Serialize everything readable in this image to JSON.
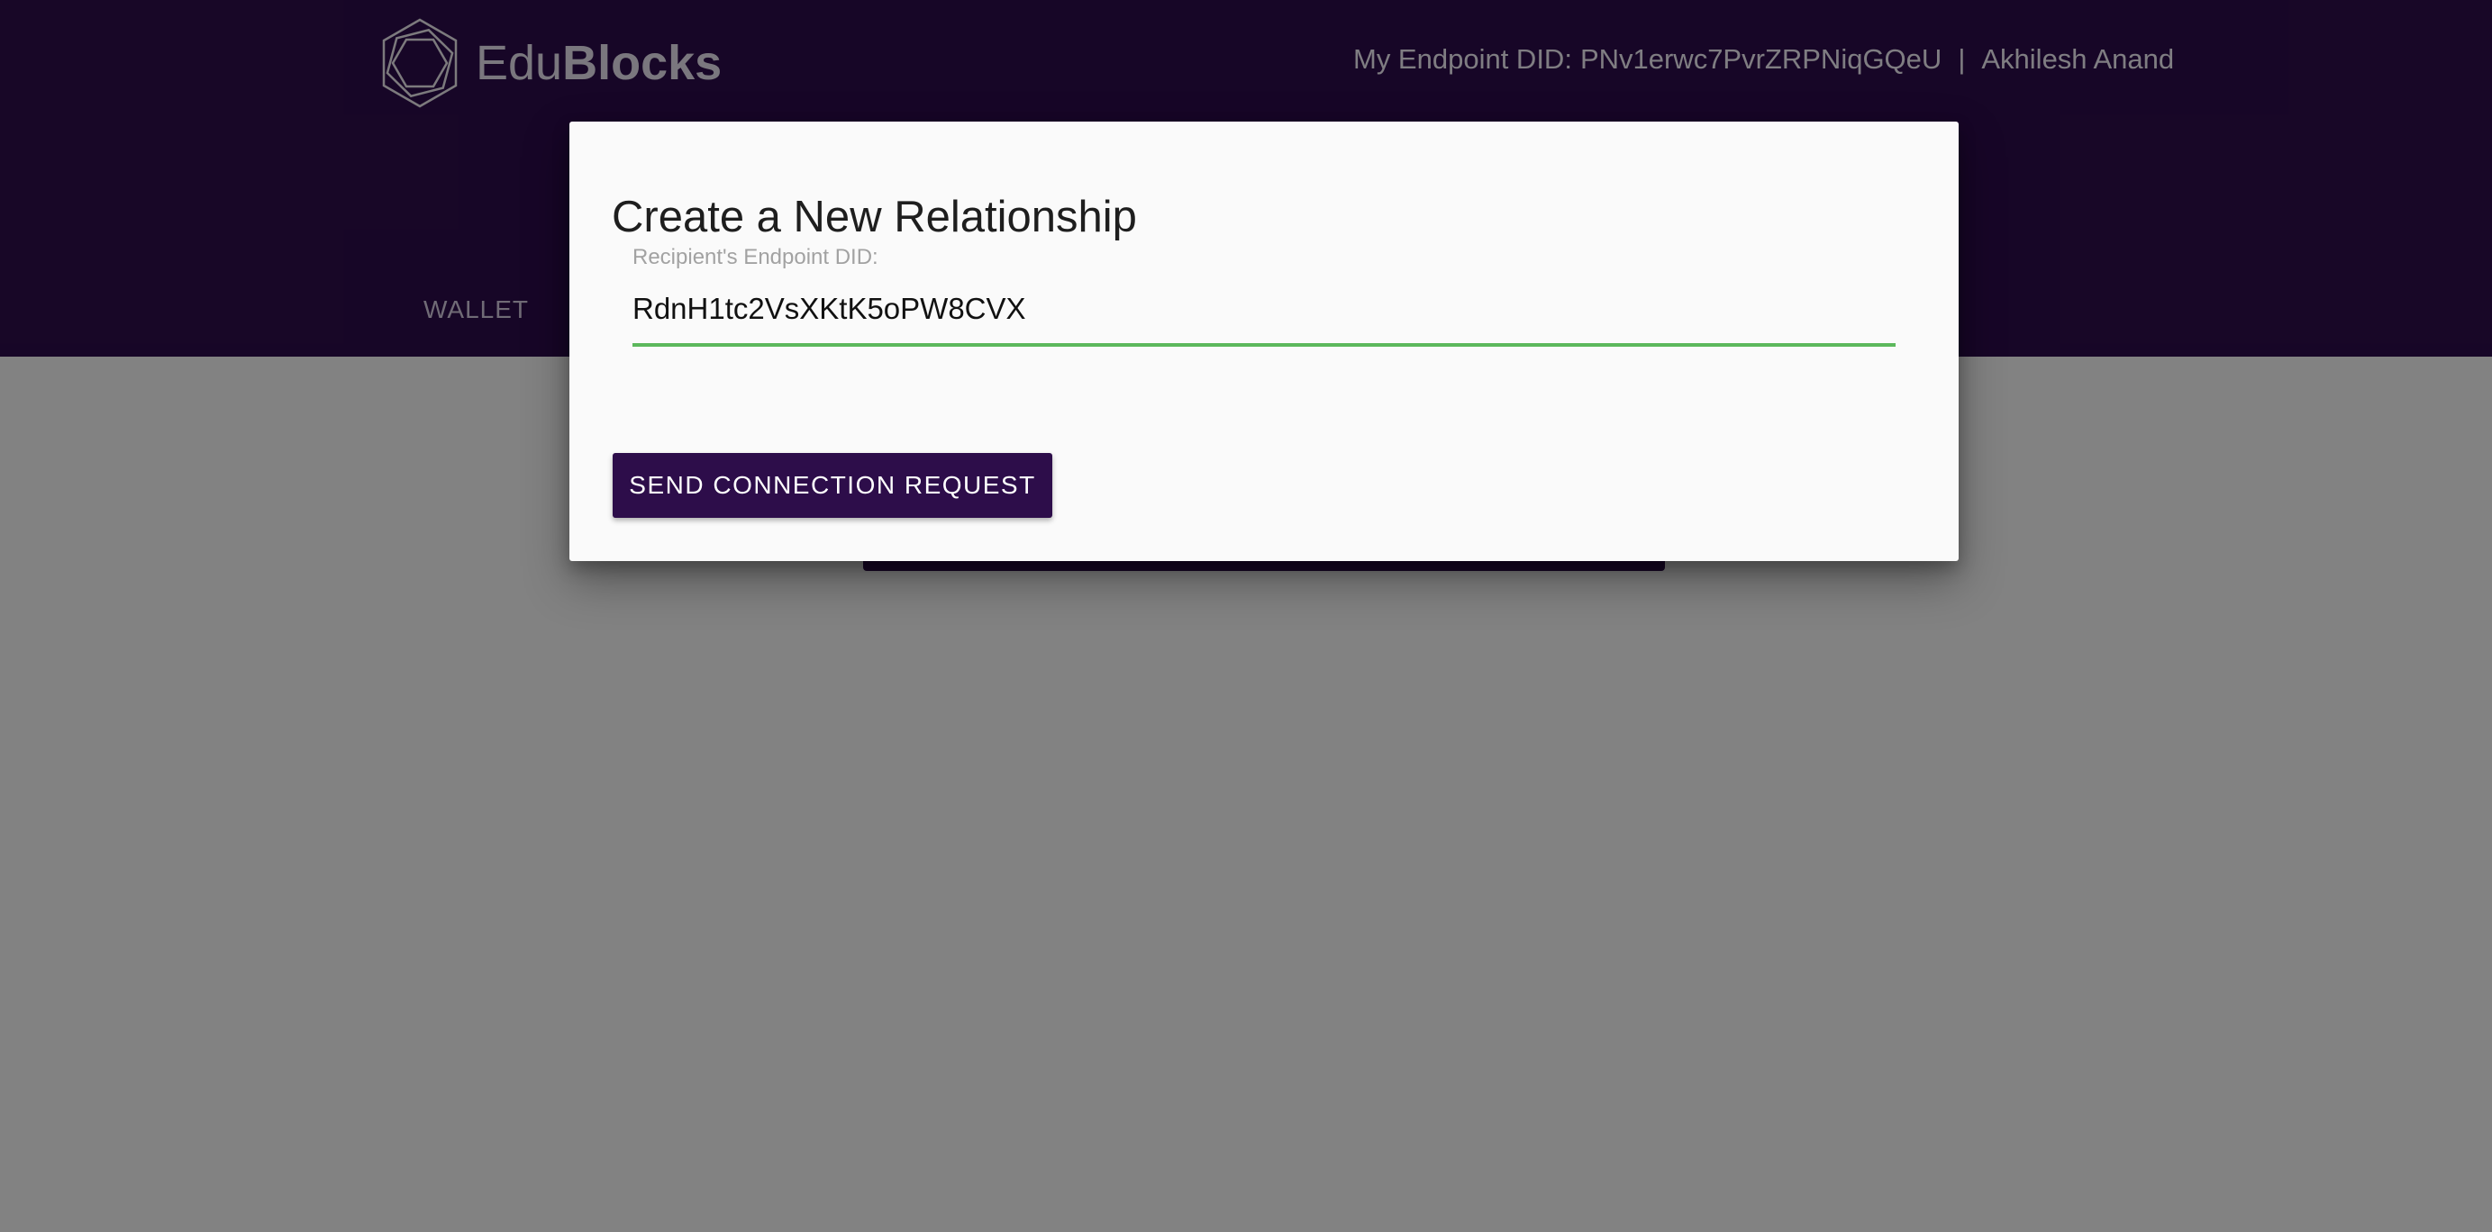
{
  "header": {
    "brand": {
      "name_part1": "Edu",
      "name_part2": "Blocks",
      "logo_icon": "hexagon-logo-icon"
    },
    "endpoint_label": "My Endpoint DID:",
    "endpoint_did": "PNv1erwc7PvrZRPNiqGQeU",
    "separator": "|",
    "user_name": "Akhilesh Anand",
    "nav": {
      "wallet_label": "WALLET"
    }
  },
  "dialog": {
    "title": "Create a New Relationship",
    "recipient_field": {
      "label": "Recipient's Endpoint DID:",
      "value": "RdnH1tc2VsXKtK5oPW8CVX",
      "placeholder": ""
    },
    "send_button_label": "SEND CONNECTION REQUEST"
  },
  "colors": {
    "header_bg": "#2d0d4a",
    "primary_button": "#2d0d4a",
    "input_underline_valid": "#5cb85c",
    "dialog_bg": "#fafafa",
    "overlay": "rgba(0,0,0,0.47)"
  }
}
